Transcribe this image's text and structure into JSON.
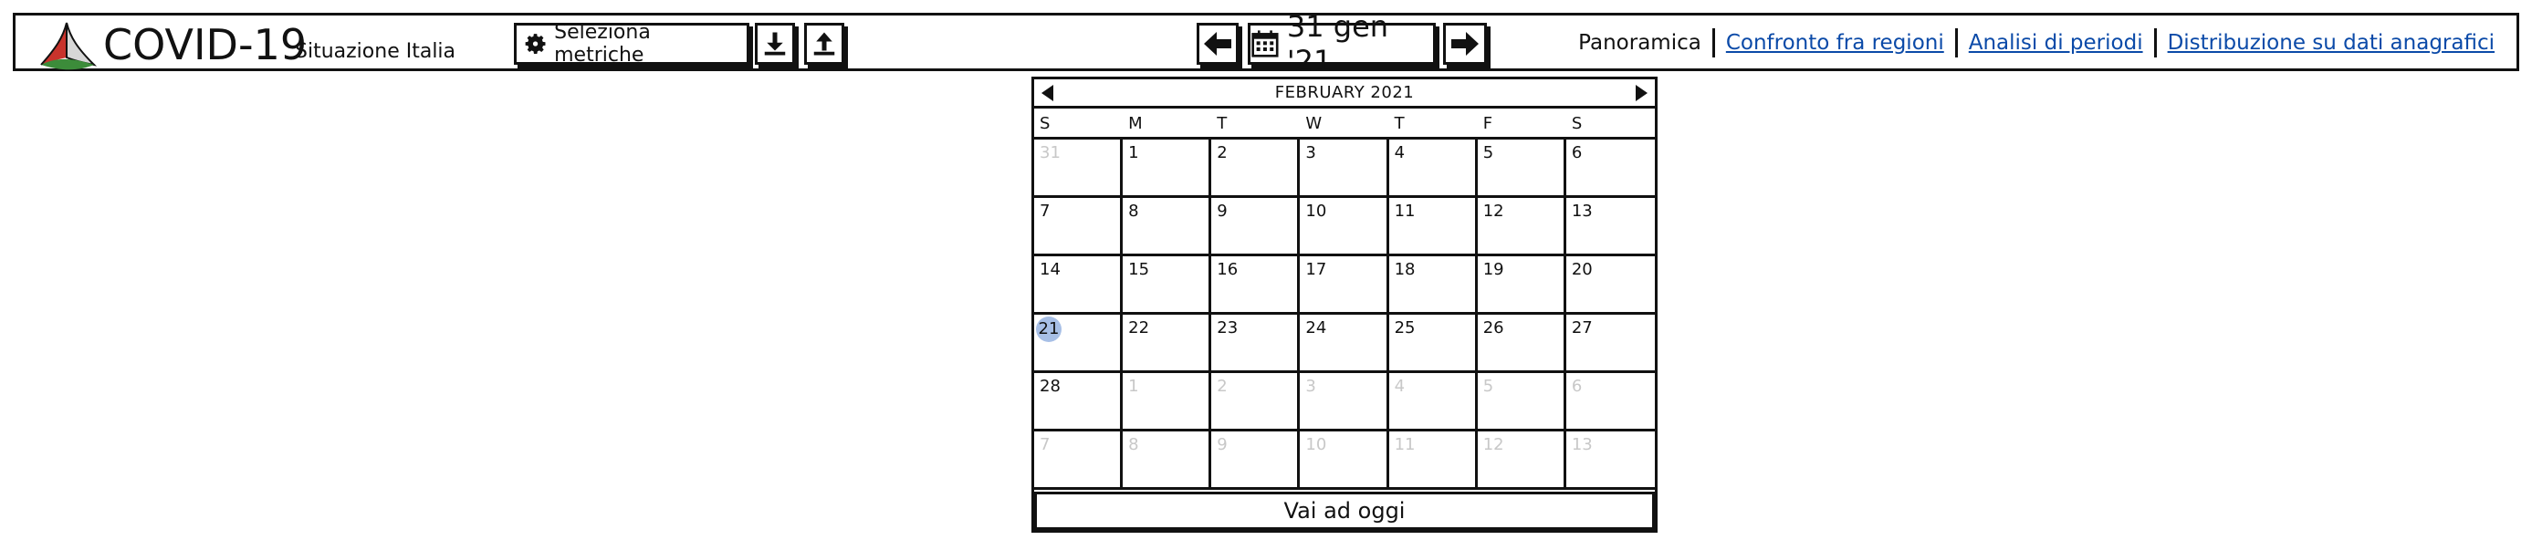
{
  "header": {
    "title": "COVID-19",
    "subtitle": "Situazione Italia",
    "metrics_button_label": "Seleziona metriche",
    "current_date_label": "31 gen '21"
  },
  "nav": {
    "items": [
      {
        "label": "Panoramica",
        "active": true
      },
      {
        "label": "Confronto fra regioni",
        "active": false
      },
      {
        "label": "Analisi di periodi",
        "active": false
      },
      {
        "label": "Distribuzione su dati anagrafici",
        "active": false
      }
    ]
  },
  "calendar": {
    "month_label": "FEBRUARY 2021",
    "weekdays": [
      "S",
      "M",
      "T",
      "W",
      "T",
      "F",
      "S"
    ],
    "days": [
      {
        "d": "31",
        "muted": true
      },
      {
        "d": "1"
      },
      {
        "d": "2"
      },
      {
        "d": "3"
      },
      {
        "d": "4"
      },
      {
        "d": "5"
      },
      {
        "d": "6"
      },
      {
        "d": "7"
      },
      {
        "d": "8"
      },
      {
        "d": "9"
      },
      {
        "d": "10"
      },
      {
        "d": "11"
      },
      {
        "d": "12"
      },
      {
        "d": "13"
      },
      {
        "d": "14"
      },
      {
        "d": "15"
      },
      {
        "d": "16"
      },
      {
        "d": "17"
      },
      {
        "d": "18"
      },
      {
        "d": "19"
      },
      {
        "d": "20"
      },
      {
        "d": "21",
        "today": true
      },
      {
        "d": "22"
      },
      {
        "d": "23"
      },
      {
        "d": "24"
      },
      {
        "d": "25"
      },
      {
        "d": "26"
      },
      {
        "d": "27"
      },
      {
        "d": "28"
      },
      {
        "d": "1",
        "muted": true
      },
      {
        "d": "2",
        "muted": true
      },
      {
        "d": "3",
        "muted": true
      },
      {
        "d": "4",
        "muted": true
      },
      {
        "d": "5",
        "muted": true
      },
      {
        "d": "6",
        "muted": true
      },
      {
        "d": "7",
        "muted": true
      },
      {
        "d": "8",
        "muted": true
      },
      {
        "d": "9",
        "muted": true
      },
      {
        "d": "10",
        "muted": true
      },
      {
        "d": "11",
        "muted": true
      },
      {
        "d": "12",
        "muted": true
      },
      {
        "d": "13",
        "muted": true
      }
    ],
    "today_button_label": "Vai ad oggi"
  },
  "icons": {
    "logo": "covid-logo-icon",
    "metrics": "gear-icon",
    "download": "download-icon",
    "upload": "upload-icon",
    "prev": "arrow-left-icon",
    "calendar": "calendar-icon",
    "next": "arrow-right-icon"
  },
  "colors": {
    "link": "#0b4aa8",
    "today_highlight": "#a7bfe6",
    "logo_green": "#3c8c3a",
    "logo_red": "#c8332c"
  }
}
